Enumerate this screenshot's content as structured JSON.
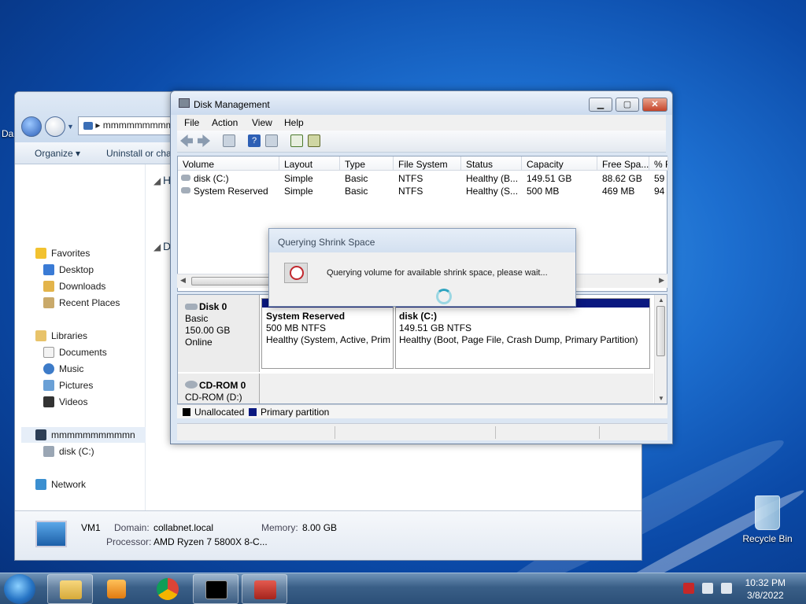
{
  "desktop": {
    "recycle_bin_label": "Recycle Bin",
    "left_edge_label": "Da"
  },
  "explorer": {
    "address": "mmmmmmmmm",
    "toolbar": {
      "organize": "Organize ▾",
      "uninstall": "Uninstall or cha"
    },
    "nav": {
      "favorites": "Favorites",
      "desktop": "Desktop",
      "downloads": "Downloads",
      "recent_places": "Recent Places",
      "libraries": "Libraries",
      "documents": "Documents",
      "music": "Music",
      "pictures": "Pictures",
      "videos": "Videos",
      "computer": "mmmmmmmmmmn",
      "disk_c": "disk (C:)",
      "network": "Network"
    },
    "content_fragments": {
      "h": "H",
      "d": "D"
    },
    "details": {
      "name": "VM1",
      "domain_label": "Domain:",
      "domain_value": "collabnet.local",
      "memory_label": "Memory:",
      "memory_value": "8.00 GB",
      "processor_label": "Processor:",
      "processor_value": "AMD Ryzen 7 5800X 8-C..."
    }
  },
  "disk_management": {
    "title": "Disk Management",
    "menu": {
      "file": "File",
      "action": "Action",
      "view": "View",
      "help": "Help"
    },
    "columns": [
      "Volume",
      "Layout",
      "Type",
      "File System",
      "Status",
      "Capacity",
      "Free Spa...",
      "% F"
    ],
    "volumes": [
      {
        "volume": "disk (C:)",
        "layout": "Simple",
        "type": "Basic",
        "fs": "NTFS",
        "status": "Healthy (B...",
        "capacity": "149.51 GB",
        "free": "88.62 GB",
        "pct": "59"
      },
      {
        "volume": "System Reserved",
        "layout": "Simple",
        "type": "Basic",
        "fs": "NTFS",
        "status": "Healthy (S...",
        "capacity": "500 MB",
        "free": "469 MB",
        "pct": "94"
      }
    ],
    "disks": {
      "disk0": {
        "name": "Disk 0",
        "kind": "Basic",
        "size": "150.00 GB",
        "state": "Online"
      },
      "cdrom0": {
        "name": "CD-ROM 0",
        "drive": "CD-ROM (D:)"
      }
    },
    "partitions": [
      {
        "name": "System Reserved",
        "size": "500 MB NTFS",
        "status": "Healthy (System, Active, Prim"
      },
      {
        "name": "disk  (C:)",
        "size": "149.51 GB NTFS",
        "status": "Healthy (Boot, Page File, Crash Dump, Primary Partition)"
      }
    ],
    "legend": {
      "unallocated": "Unallocated",
      "primary": "Primary partition"
    }
  },
  "dialog": {
    "title": "Querying Shrink Space",
    "message": "Querying volume for available shrink space, please wait..."
  },
  "taskbar": {
    "time": "10:32 PM",
    "date": "3/8/2022"
  }
}
